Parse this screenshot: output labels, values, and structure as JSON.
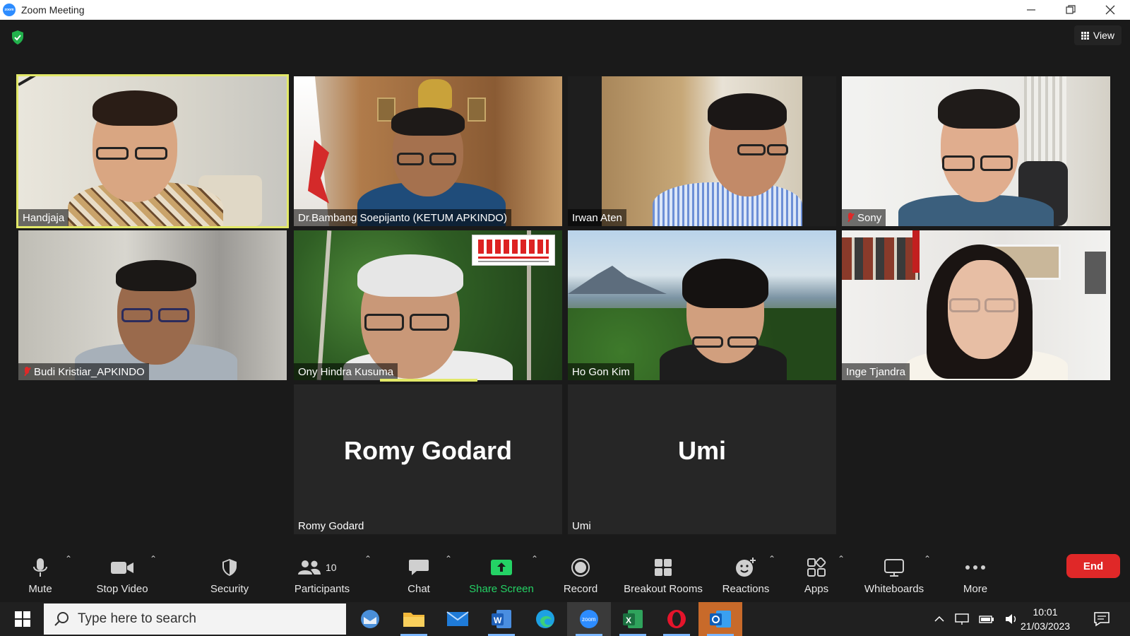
{
  "window": {
    "title": "Zoom Meeting",
    "app_logo_text": "zoom"
  },
  "view_button": {
    "label": "View"
  },
  "participants": [
    {
      "name": "Handjaja",
      "muted": false,
      "active_speaker": true
    },
    {
      "name": "Dr.Bambang Soepijanto (KETUM APKINDO)",
      "muted": false
    },
    {
      "name": "Irwan Aten",
      "muted": false
    },
    {
      "name": "Sony",
      "muted": true
    },
    {
      "name": "Budi Kristiar_APKINDO",
      "muted": true
    },
    {
      "name": "Ony Hindra Kusuma",
      "muted": false,
      "talking": true
    },
    {
      "name": "Ho Gon Kim",
      "muted": false
    },
    {
      "name": "Inge Tjandra",
      "muted": false
    },
    {
      "name": "Romy Godard",
      "display_name": "Romy Godard",
      "video_off": true
    },
    {
      "name": "Umi",
      "display_name": "Umi",
      "video_off": true
    }
  ],
  "toolbar": {
    "mute": "Mute",
    "stop_video": "Stop Video",
    "security": "Security",
    "participants": "Participants",
    "participants_count": "10",
    "chat": "Chat",
    "share_screen": "Share Screen",
    "record": "Record",
    "breakout_rooms": "Breakout Rooms",
    "reactions": "Reactions",
    "apps": "Apps",
    "whiteboards": "Whiteboards",
    "more": "More",
    "end": "End"
  },
  "taskbar": {
    "search_placeholder": "Type here to search",
    "time": "10:01",
    "date": "21/03/2023"
  },
  "colors": {
    "active_speaker_border": "#e2e868",
    "share_green": "#24d265",
    "end_red": "#e02828"
  }
}
